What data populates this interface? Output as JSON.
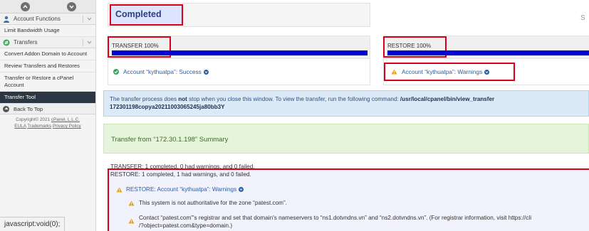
{
  "sidebar": {
    "account_functions": "Account Functions",
    "limit_bandwidth": "Limit Bandwidth Usage",
    "transfers": "Transfers",
    "items": [
      "Convert Addon Domain to Account",
      "Review Transfers and Restores",
      "Transfer or Restore a cPanel Account",
      "Transfer Tool"
    ],
    "back_to_top": "Back To Top",
    "copyright": "Copyright© 2021",
    "cpanel_link": "cPanel, L.L.C.",
    "eula": "EULA",
    "trademarks": "Trademarks",
    "privacy": "Privacy Policy"
  },
  "status_bar": "javascript:void(0);",
  "main": {
    "title": "Completed",
    "right_stub": "S",
    "transfer": {
      "label": "TRANSFER 100%",
      "progress": 100,
      "status": "Account “kythuatpa”: Success"
    },
    "restore": {
      "label": "RESTORE 100%",
      "progress": 100,
      "status": "Account “kythuatpa”: Warnings"
    },
    "info": {
      "part1": "The transfer process does ",
      "bold_word": "not",
      "part2": " stop when you close this window. To view the transfer, run the following command: ",
      "command": "/usr/local/cpanel/bin/view_transfer",
      "command_cont": "172301198copya20211003065245ja80bb3Y"
    },
    "summary_title": "Transfer from “172.30.1.198” Summary",
    "transfer_summary": "TRANSFER: 1 completed, 0 had warnings, and 0 failed.",
    "restore_summary": "RESTORE: 1 completed, 1 had warnings, and 0 failed.",
    "restore_account_warning": "RESTORE: Account “kythuatpa”: Warnings",
    "warning_1": "This system is not authoritative for the zone “patest.com”.",
    "warning_2": "Contact “patest.com”'s registrar and set that domain's nameservers to “ns1.dotvndns.vn” and “ns2.dotvndns.vn”. (For registrar information, visit https://cli",
    "warning_2_cont": "/?object=patest.com&type=domain.)"
  },
  "colors": {
    "progress": "#0000d6",
    "highlight_box": "#d9001b",
    "info_bg": "#dceaf8",
    "summary_bg": "#e7f4dc",
    "active_nav": "#2b3743"
  }
}
